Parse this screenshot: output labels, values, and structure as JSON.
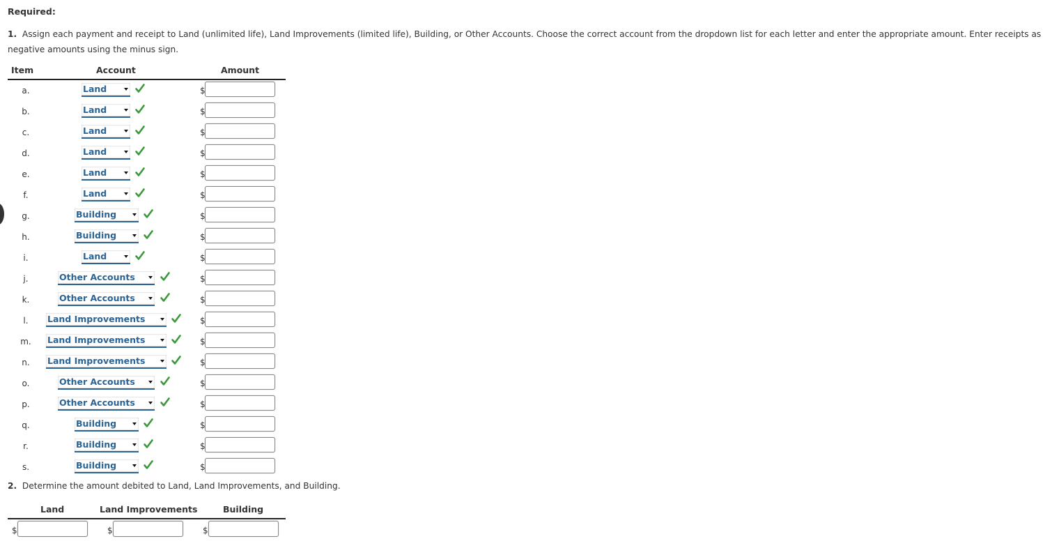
{
  "heading": "Required:",
  "part1": {
    "number": "1.",
    "instruction": "Assign each payment and receipt to Land (unlimited life), Land Improvements (limited life), Building, or Other Accounts. Choose the correct account from the dropdown list for each letter and enter the appropriate amount. Enter receipts as negative amounts using the minus sign.",
    "columns": {
      "item": "Item",
      "account": "Account",
      "amount": "Amount"
    },
    "currency_symbol": "$",
    "rows": [
      {
        "item": "a.",
        "account": "Land",
        "status": "correct",
        "amount": ""
      },
      {
        "item": "b.",
        "account": "Land",
        "status": "correct",
        "amount": ""
      },
      {
        "item": "c.",
        "account": "Land",
        "status": "correct",
        "amount": ""
      },
      {
        "item": "d.",
        "account": "Land",
        "status": "correct",
        "amount": ""
      },
      {
        "item": "e.",
        "account": "Land",
        "status": "correct",
        "amount": ""
      },
      {
        "item": "f.",
        "account": "Land",
        "status": "correct",
        "amount": ""
      },
      {
        "item": "g.",
        "account": "Building",
        "status": "correct",
        "amount": ""
      },
      {
        "item": "h.",
        "account": "Building",
        "status": "correct",
        "amount": ""
      },
      {
        "item": "i.",
        "account": "Land",
        "status": "correct",
        "amount": ""
      },
      {
        "item": "j.",
        "account": "Other Accounts",
        "status": "correct",
        "amount": ""
      },
      {
        "item": "k.",
        "account": "Other Accounts",
        "status": "correct",
        "amount": ""
      },
      {
        "item": "l.",
        "account": "Land Improvements",
        "status": "correct",
        "amount": ""
      },
      {
        "item": "m.",
        "account": "Land Improvements",
        "status": "correct",
        "amount": ""
      },
      {
        "item": "n.",
        "account": "Land Improvements",
        "status": "correct",
        "amount": ""
      },
      {
        "item": "o.",
        "account": "Other Accounts",
        "status": "correct",
        "amount": ""
      },
      {
        "item": "p.",
        "account": "Other Accounts",
        "status": "correct",
        "amount": ""
      },
      {
        "item": "q.",
        "account": "Building",
        "status": "correct",
        "amount": ""
      },
      {
        "item": "r.",
        "account": "Building",
        "status": "correct",
        "amount": ""
      },
      {
        "item": "s.",
        "account": "Building",
        "status": "correct",
        "amount": ""
      }
    ]
  },
  "part2": {
    "number": "2.",
    "instruction": "Determine the amount debited to Land, Land Improvements, and Building.",
    "columns": [
      "Land",
      "Land Improvements",
      "Building"
    ],
    "currency_symbol": "$",
    "values": [
      "",
      "",
      ""
    ]
  },
  "colors": {
    "select_text": "#2a6496",
    "check": "#3a9a3a",
    "text": "#333333"
  }
}
